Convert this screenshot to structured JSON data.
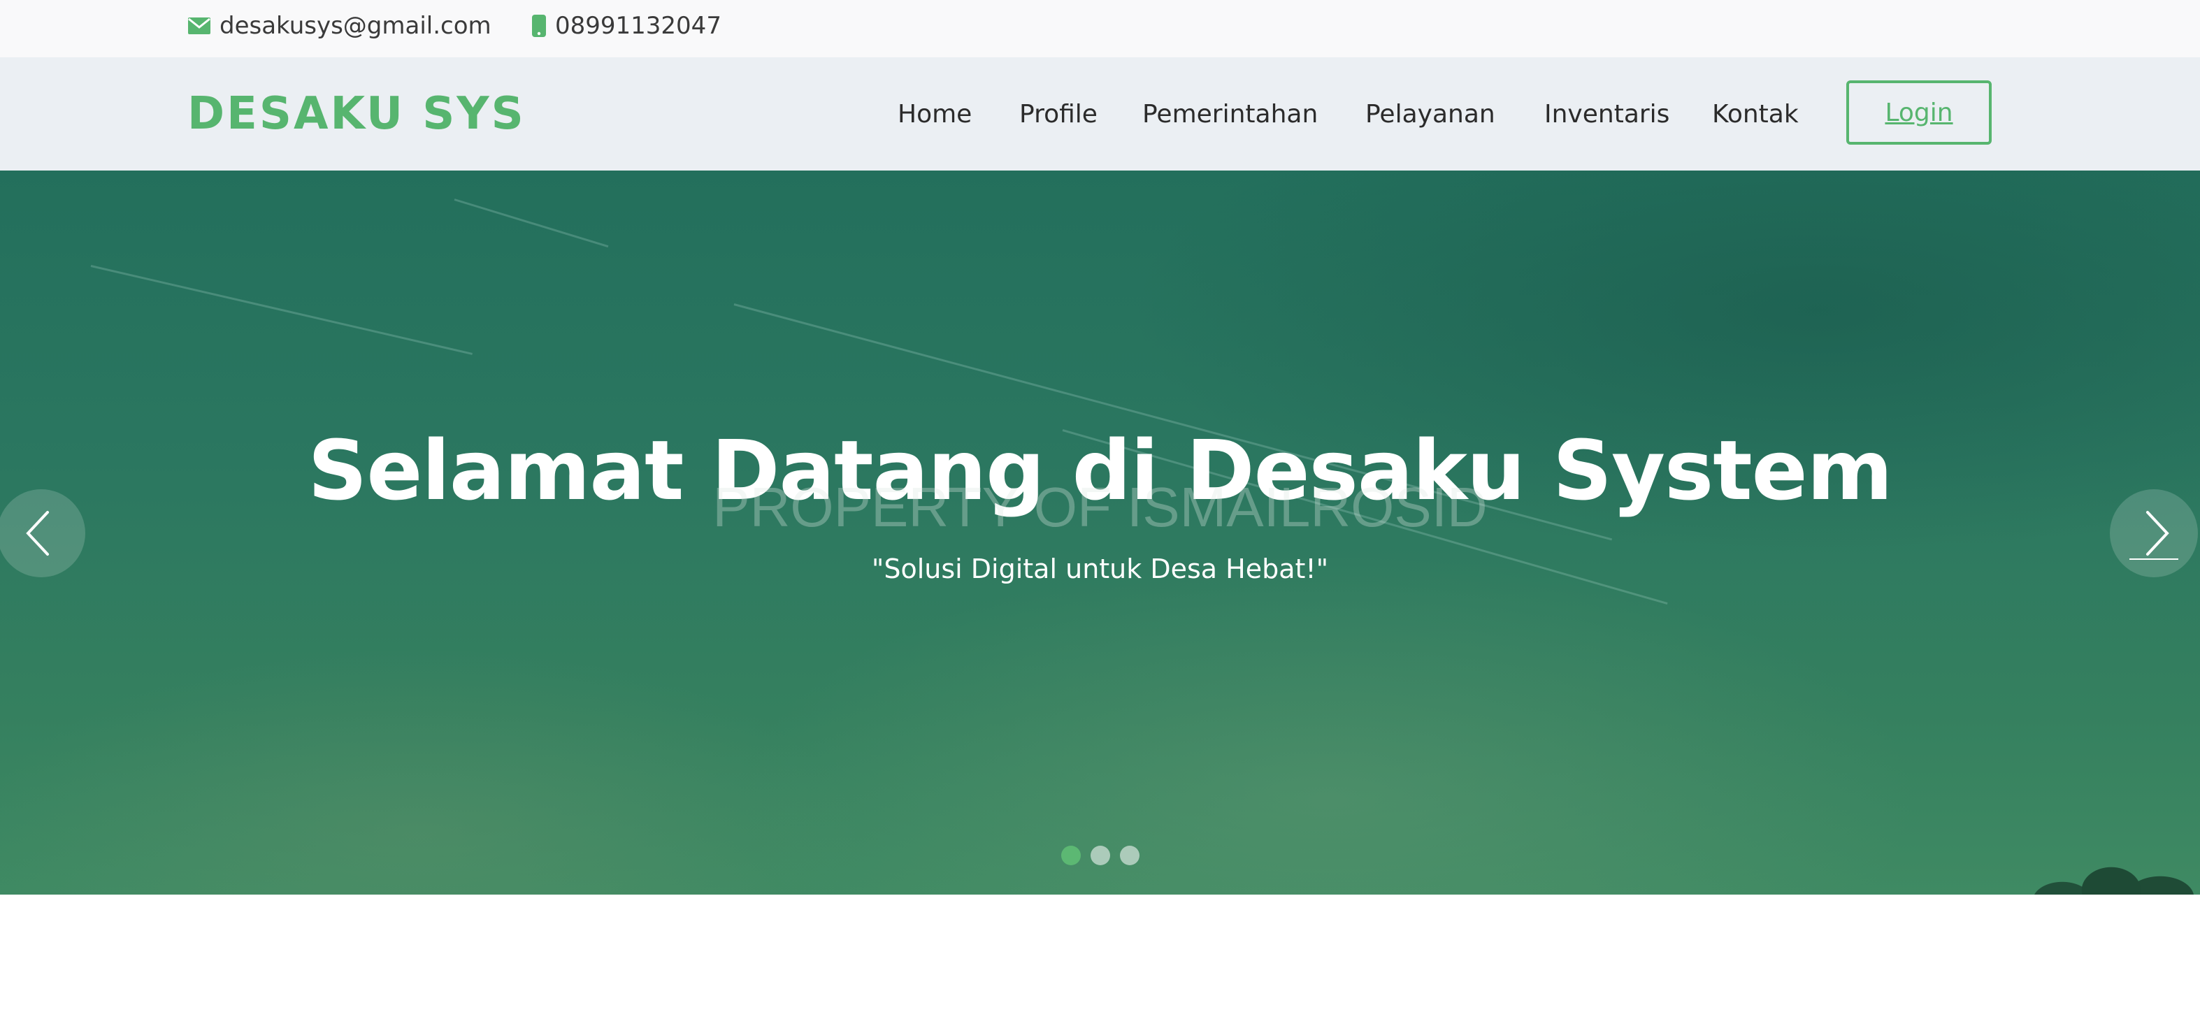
{
  "topbar": {
    "email": "desakusys@gmail.com",
    "phone": "08991132047",
    "email_icon": "envelope-icon",
    "phone_icon": "mobile-phone-icon"
  },
  "header": {
    "logo": "DESAKU SYS",
    "nav": [
      {
        "label": "Home",
        "active": true
      },
      {
        "label": "Profile",
        "active": false
      },
      {
        "label": "Pemerintahan",
        "active": false
      },
      {
        "label": "Pelayanan",
        "active": false
      },
      {
        "label": "Inventaris",
        "active": false
      },
      {
        "label": "Kontak",
        "active": false
      }
    ],
    "login_label": "Login"
  },
  "hero": {
    "title": "Selamat Datang di Desaku System",
    "watermark": "PROPERTY OF ISMAILROSID",
    "subtitle": "\"Solusi Digital untuk Desa Hebat!\"",
    "slide_count": 3,
    "active_slide": 0,
    "prev_icon": "chevron-left-icon",
    "next_icon": "chevron-right-icon"
  },
  "colors": {
    "accent": "#57b56f",
    "hero_overlay": "#236f5c",
    "text_dark": "#2b2b2b"
  }
}
